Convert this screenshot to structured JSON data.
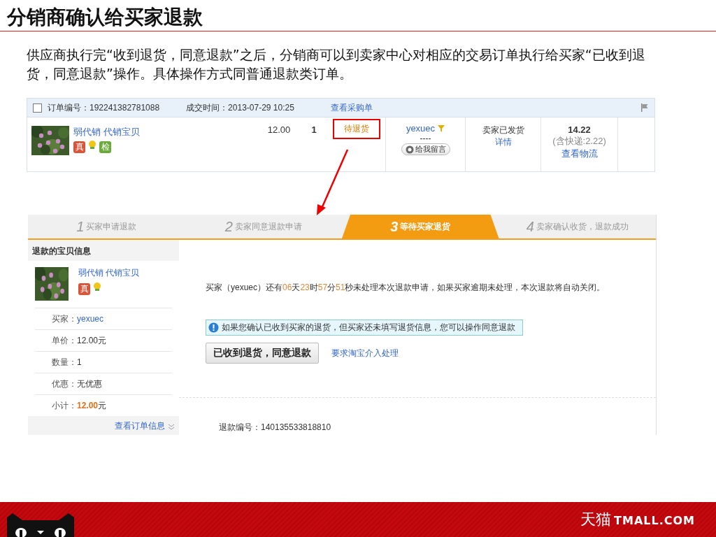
{
  "title": "分销商确认给买家退款",
  "description": "供应商执行完“收到退货，同意退款”之后，分销商可以到卖家中心对相应的交易订单执行给买家“已收到退货，同意退款”操作。具体操作方式同普通退款类订单。",
  "order": {
    "checked": false,
    "order_no": "订单编号：192241382781088",
    "deal_time": "成交时间：2013-07-29 10:25",
    "purchase_link": "查看采购单",
    "item": {
      "title": "弱代销 代销宝贝",
      "badges": [
        {
          "kind": "label",
          "text": "真"
        },
        {
          "kind": "lamp"
        },
        {
          "kind": "label",
          "text": "检"
        }
      ],
      "price": "12.00",
      "qty": "1",
      "status": "待退货",
      "buyer": "yexuec",
      "buyer_extra": "----",
      "message_button": "给我留言",
      "seller_status": "卖家已发货",
      "detail_link": "详情",
      "total": "14.22",
      "shipping": "(含快递:2.22)",
      "logistics_link": "查看物流"
    }
  },
  "steps": [
    {
      "number": "1",
      "label": "买家申请退款",
      "selected": false
    },
    {
      "number": "2",
      "label": "卖家同意退款申请",
      "selected": false
    },
    {
      "number": "3",
      "label": "等待买家退货",
      "selected": true
    },
    {
      "number": "4",
      "label": "卖家确认收货，退款成功",
      "selected": false
    }
  ],
  "sidebar": {
    "heading": "退款的宝贝信息",
    "item_title": "弱代销 代销宝贝",
    "badges": [
      {
        "kind": "label",
        "text": "真"
      },
      {
        "kind": "lamp"
      }
    ],
    "rows": [
      {
        "label": "买家：",
        "value": "yexuec",
        "kind": "link"
      },
      {
        "label": "单价：",
        "value": "12.00元",
        "kind": "text"
      },
      {
        "label": "数量：",
        "value": "1",
        "kind": "text"
      },
      {
        "label": "优惠：",
        "value": "无优惠",
        "kind": "text"
      },
      {
        "label": "小计：",
        "value": "**12.00**元",
        "kind": "text"
      }
    ],
    "more_link": "查看订单信息"
  },
  "main": {
    "countdown": [
      {
        "text": "买家（yexuec）还有",
        "highlight": false
      },
      {
        "text": "06",
        "highlight": true
      },
      {
        "text": "天",
        "highlight": false
      },
      {
        "text": "23",
        "highlight": true
      },
      {
        "text": "时",
        "highlight": false
      },
      {
        "text": "57",
        "highlight": true
      },
      {
        "text": "分",
        "highlight": false
      },
      {
        "text": "51",
        "highlight": true
      },
      {
        "text": "秒未处理本次退款申请，如果买家逾期未处理，本次退款将自动关闭。",
        "highlight": false
      }
    ],
    "notice": "如果您确认已收到买家的退货，但买家还未填写退货信息，您可以操作同意退款",
    "confirm_button": "已收到退货，同意退款",
    "intervene_link": "要求淘宝介入处理",
    "refund_no": "退款编号：140135533818810"
  },
  "footer": {
    "brand_cn": "天猫",
    "brand_en": "TMALL.COM"
  }
}
